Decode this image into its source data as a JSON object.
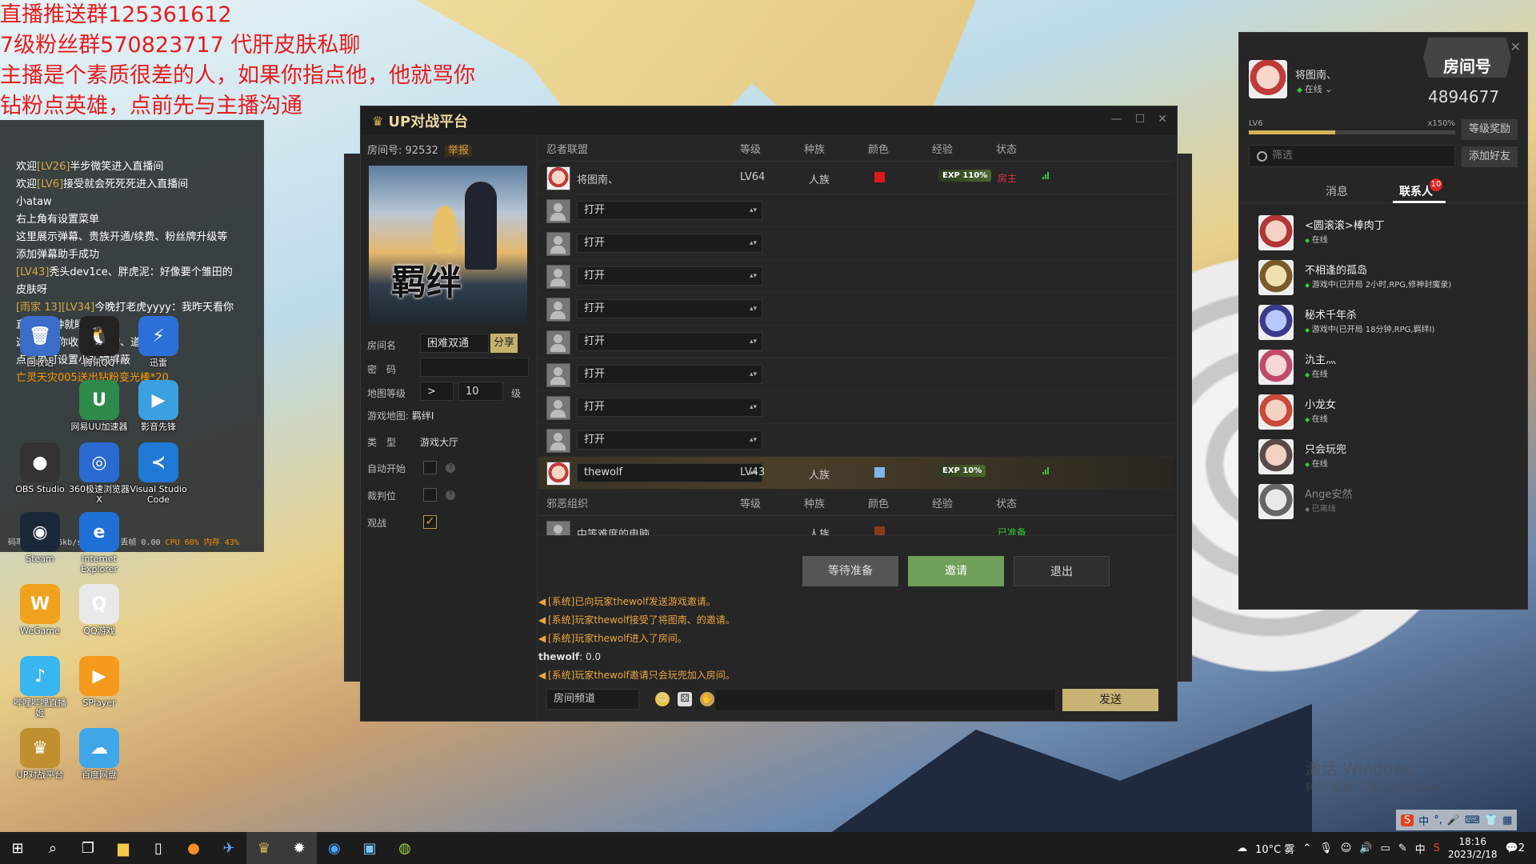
{
  "overlay": {
    "lines": [
      "直播推送群125361612",
      "7级粉丝群570823717 代肝皮肤私聊",
      "主播是个素质很差的人，如果你指点他，他就骂你",
      "钻粉点英雄，点前先与主播沟通"
    ]
  },
  "chat": {
    "lines": [
      {
        "a": "欢迎",
        "lv": "[LV26]",
        "b": "半步微笑进入直播间"
      },
      {
        "a": "欢迎",
        "lv": "[LV6]",
        "b": "接受就会死死死进入直播间"
      },
      {
        "a": "小",
        "lv": "",
        "b": "ataw"
      },
      {
        "a": "右上角有设置菜单",
        "lv": "",
        "b": ""
      },
      {
        "a": "这里展示弹幕、贵族开通/续费、粉丝牌升级等",
        "lv": "",
        "b": ""
      },
      {
        "a": "添加弹幕助手成功",
        "lv": "",
        "b": ""
      },
      {
        "a": "",
        "lv": "[LV43]",
        "b": "秃头dev1ce、胖虎泥：好像要个雏田的"
      },
      {
        "a": "皮肤呀",
        "lv": "",
        "b": ""
      },
      {
        "a": "",
        "lv": "[雨家 13][LV34]",
        "b": "今晚打老虎yyyy：我昨天看你"
      },
      {
        "a": "直播8点钟就睡着了",
        "lv": "",
        "b": ""
      },
      {
        "a": "这里展示你收到的礼物、道具",
        "lv": "",
        "b": ""
      },
      {
        "a": "点菜单可设置小礼物屏蔽",
        "lv": "",
        "b": ""
      },
      {
        "a": "",
        "lv": "",
        "b": "",
        "sys": "亡灵天灾005送出钻粉变光棒*20"
      }
    ],
    "stats": "码率 287 376kb/s FPS 30 丢帧 0.00",
    "stats_warn": "CPU 60% 内存 43%"
  },
  "desktop": {
    "icons": [
      {
        "label": "回收站",
        "glyph": "🗑"
      },
      {
        "label": "腾讯QQ",
        "glyph": "🐧"
      },
      {
        "label": "迅雷",
        "glyph": "⚡"
      },
      {
        "label": "网易UU加速器",
        "glyph": "U"
      },
      {
        "label": "影音先锋",
        "glyph": "▶"
      },
      {
        "label": "OBS Studio",
        "glyph": "●"
      },
      {
        "label": "360极速浏览器X",
        "glyph": "◎"
      },
      {
        "label": "Visual Studio Code",
        "glyph": "≺"
      },
      {
        "label": "Steam",
        "glyph": "◉"
      },
      {
        "label": "Internet Explorer",
        "glyph": "e"
      },
      {
        "label": "WeGame",
        "glyph": "W"
      },
      {
        "label": "QQ游戏",
        "glyph": "Q"
      },
      {
        "label": "哔哩哔哩直播姬",
        "glyph": "♪"
      },
      {
        "label": "SPlayer",
        "glyph": "▶"
      },
      {
        "label": "UP对战平台",
        "glyph": "♛"
      },
      {
        "label": "百度网盘",
        "glyph": "☁"
      }
    ]
  },
  "window": {
    "title": "UP对战平台",
    "room_no_label": "房间号:",
    "room_no": "92532",
    "report": "举报",
    "map_caption": "羁绊",
    "room_name_label": "房间名",
    "room_name": "困难双通",
    "share": "分享",
    "password_label": "密　码",
    "map_level_label": "地图等级",
    "map_level_op": ">",
    "map_level_value": "10",
    "map_level_unit": "级",
    "game_map_label": "游戏地图:",
    "game_map": "羁绊I",
    "type_label": "类　型",
    "type_value": "游戏大厅",
    "auto_start_label": "自动开始",
    "referee_label": "裁判位",
    "spectate_label": "观战",
    "team1": "忍者联盟",
    "team2": "邪恶组织",
    "headers": {
      "level": "等级",
      "race": "种族",
      "color": "颜色",
      "exp": "经验",
      "status": "状态"
    },
    "host": {
      "name": "将图南、",
      "level": "LV64",
      "race": "人族",
      "color": "#e01818",
      "exp": "EXP 110%",
      "status": "房主"
    },
    "open_label": "打开",
    "player2": {
      "name": "thewolf",
      "level": "LV43",
      "race": "人族",
      "color": "#7fb7e8",
      "exp": "EXP 10%"
    },
    "ai": {
      "name": "中等难度的电脑",
      "race": "人族",
      "color": "#8a3a1a",
      "status": "已准备"
    },
    "buttons": {
      "wait": "等待准备",
      "invite": "邀请",
      "quit": "退出"
    },
    "log": [
      {
        "type": "sys",
        "text": "[系统]已向玩家thewolf发送游戏邀请。"
      },
      {
        "type": "sys",
        "text": "[系统]玩家thewolf接受了将图南、的邀请。"
      },
      {
        "type": "sys",
        "text": "[系统]玩家thewolf进入了房间。"
      },
      {
        "type": "usr",
        "user": "thewolf",
        "text": ": 0.0"
      },
      {
        "type": "sys",
        "text": "[系统]玩家thewolf邀请只会玩兜加入房间。"
      }
    ],
    "channel": "房间频道",
    "send": "发送"
  },
  "friends": {
    "user_name": "将图南、",
    "user_status": "在线",
    "room_badge": "房间号",
    "room_num": "4894677",
    "level": "LV6",
    "exp_pct": "x150%",
    "level_progress": 0.42,
    "level_reward": "等级奖励",
    "add_friend": "添加好友",
    "filter_placeholder": "筛选",
    "tab_msg": "消息",
    "tab_contacts": "联系人",
    "badge": "10",
    "list": [
      {
        "name": "<圆滚滚>棒肉丁",
        "status": "在线",
        "online": true,
        "c1": "#f3d2c4",
        "c2": "#b23636"
      },
      {
        "name": "不相逢的孤岛",
        "status": "游戏中(已开局 2小时,RPG,修神封魔录)",
        "online": true,
        "c1": "#f0e0b0",
        "c2": "#7a5a2a"
      },
      {
        "name": "秘术千年杀",
        "status": "游戏中(已开局 18分钟,RPG,羁绊I)",
        "online": true,
        "c1": "#b8c8ff",
        "c2": "#3a3a8a"
      },
      {
        "name": "氿主灬",
        "status": "在线",
        "online": true,
        "c1": "#f6d6d6",
        "c2": "#c04a6a"
      },
      {
        "name": "小龙女",
        "status": "在线",
        "online": true,
        "c1": "#f3d2c4",
        "c2": "#c84a3a"
      },
      {
        "name": "只会玩兜",
        "status": "在线",
        "online": true,
        "c1": "#f3d2c4",
        "c2": "#5a4a4a"
      },
      {
        "name": "Ange安然",
        "status": "已离线",
        "online": false,
        "c1": "#e8e8e8",
        "c2": "#666"
      }
    ]
  },
  "taskbar": {
    "weather": "10°C 雾",
    "ime": "中",
    "time": "18:16",
    "date": "2023/2/18",
    "notif": "2"
  },
  "activation": {
    "line1": "激活 Windows",
    "line2": "转到“设置”以激活 Windows。"
  }
}
